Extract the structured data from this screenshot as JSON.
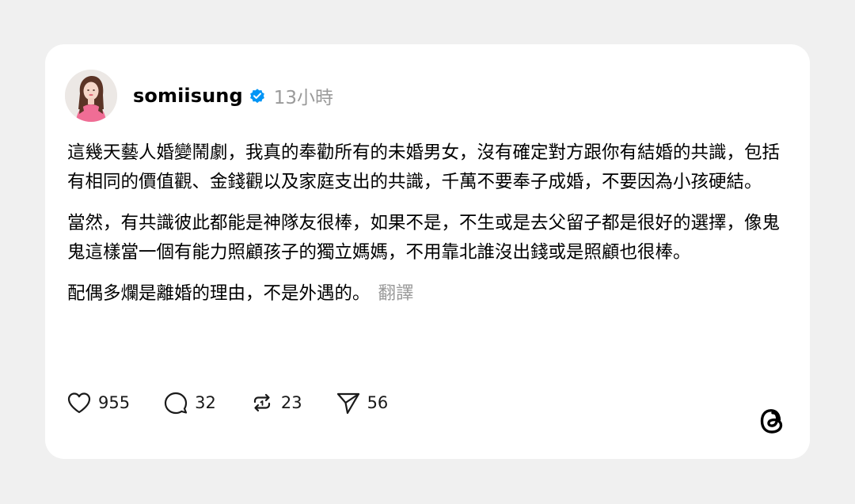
{
  "post": {
    "username": "somiisung",
    "timestamp": "13小時",
    "paragraphs": [
      "這幾天藝人婚變鬧劇，我真的奉勸所有的未婚男女，沒有確定對方跟你有結婚的共識，包括有相同的價值觀、金錢觀以及家庭支出的共識，千萬不要奉子成婚，不要因為小孩硬結。",
      "當然，有共識彼此都能是神隊友很棒，如果不是，不生或是去父留子都是很好的選擇，像鬼鬼這樣當一個有能力照顧孩子的獨立媽媽，不用靠北誰沒出錢或是照顧也很棒。",
      "配偶多爛是離婚的理由，不是外遇的。"
    ],
    "translate_label": "翻譯"
  },
  "actions": {
    "likes": "955",
    "comments": "32",
    "reposts": "23",
    "shares": "56"
  },
  "icons": {
    "verified": "verified-badge-icon",
    "like": "heart-icon",
    "comment": "comment-bubble-icon",
    "repost": "repost-icon",
    "share": "send-icon",
    "brand": "threads-logo-icon"
  },
  "colors": {
    "background": "#f0f0f0",
    "card": "#ffffff",
    "verified_blue": "#0095f6",
    "muted_text": "#9a9a9a"
  }
}
